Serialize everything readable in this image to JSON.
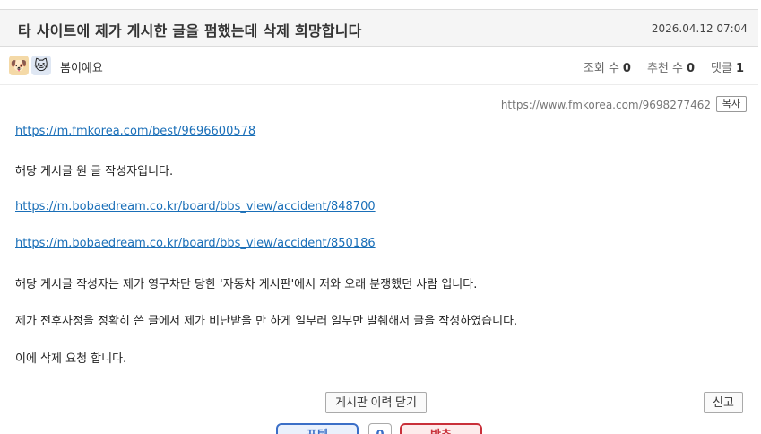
{
  "post": {
    "title": "타 사이트에 제가 게시한 글을 펌했는데 삭제 희망합니다",
    "date": "2026.04.12 07:04"
  },
  "author": {
    "name": "봄이예요",
    "avatar_icons": [
      "dog-icon",
      "cat-icon"
    ]
  },
  "stats": {
    "views_label": "조회 수",
    "views": "0",
    "recommends_label": "추천 수",
    "recommends": "0",
    "comments_label": "댓글",
    "comments": "1"
  },
  "source": {
    "url": "https://www.fmkorea.com/9698277462",
    "copy_label": "복사"
  },
  "content": {
    "link1": "https://m.fmkorea.com/best/9696600578",
    "line1": "해당 게시글 원 글 작성자입니다.",
    "link2": "https://m.bobaedream.co.kr/board/bbs_view/accident/848700",
    "link3": "https://m.bobaedream.co.kr/board/bbs_view/accident/850186",
    "line2": "해당 게시글 작성자는 제가 영구차단 당한 '자동차 게시판'에서 저와 오래 분쟁했던 사람 입니다.",
    "line3": "제가 전후사정을 정확히 쓴 글에서 제가 비난받을 만 하게 일부러 일부만 발췌해서 글을 작성하였습니다.",
    "line4": "이에 삭제 요청 합니다."
  },
  "actions": {
    "history_close": "게시판 이력 닫기",
    "report": "신고"
  },
  "vote": {
    "up_label": "포텐",
    "count": "0",
    "down_label": "반추"
  },
  "colors": {
    "link": "#1a6fb8",
    "vote_up": "#3b6fc7",
    "vote_down": "#c9303a"
  }
}
